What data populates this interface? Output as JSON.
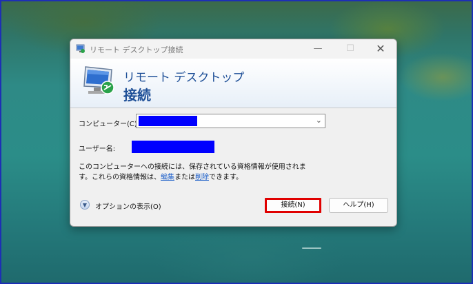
{
  "window": {
    "title": "リモート デスクトップ接続",
    "minimize_glyph": "—",
    "maximize_glyph": "☐",
    "close_glyph": "✕"
  },
  "banner": {
    "line1": "リモート デスクトップ",
    "line2": "接続"
  },
  "form": {
    "computer_label": "コンピューター(C):",
    "computer_value_redacted": true,
    "username_label": "ユーザー名:",
    "username_value_redacted": true,
    "note_part1": "このコンピューターへの接続には、保存されている資格情報が使用されます。これらの資格情報は、",
    "edit_link": "編集",
    "note_or": "または",
    "delete_link": "削除",
    "note_end": "できます。"
  },
  "footer": {
    "options_label": "オプションの表示(O)",
    "connect_button": "接続(N)",
    "help_button": "ヘルプ(H)"
  },
  "icons": {
    "app": "remote-desktop-icon",
    "options": "chevron-down-circle-icon"
  },
  "colors": {
    "redaction": "#0000ff",
    "highlight": "#e00000",
    "banner_text": "#1e4f97"
  }
}
